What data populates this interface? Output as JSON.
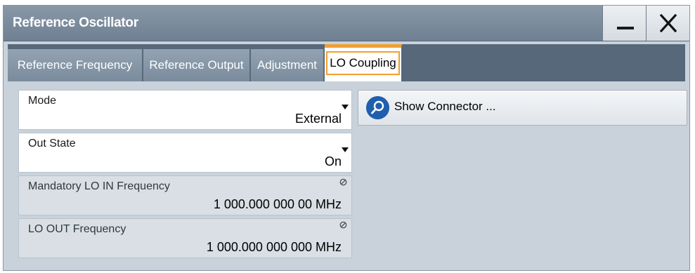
{
  "window": {
    "title": "Reference Oscillator"
  },
  "tabs": [
    {
      "label": "Reference Frequency"
    },
    {
      "label": "Reference Output"
    },
    {
      "label": "Adjustment"
    },
    {
      "label": "LO Coupling"
    }
  ],
  "fields": {
    "mode": {
      "label": "Mode",
      "value": "External"
    },
    "out_state": {
      "label": "Out State",
      "value": "On"
    },
    "lo_in_freq": {
      "label": "Mandatory LO IN Frequency",
      "value": "1 000.000 000 00 MHz"
    },
    "lo_out_freq": {
      "label": "LO OUT Frequency",
      "value": "1 000.000 000 000 MHz"
    }
  },
  "buttons": {
    "show_connector": "Show Connector ..."
  },
  "colors": {
    "accent": "#f0a030",
    "titlebar": "#7a8b9d",
    "panel": "#c9d2da",
    "icon_blue": "#1f5fae"
  }
}
